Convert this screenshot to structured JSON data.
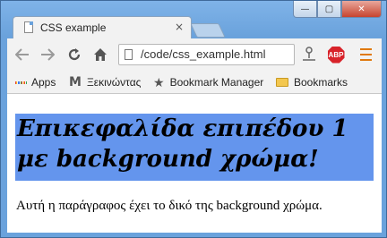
{
  "window": {
    "controls": {
      "minimize": "—",
      "maximize": "▢",
      "close": "✕"
    }
  },
  "tab": {
    "title": "CSS example",
    "close_glyph": "×"
  },
  "toolbar": {
    "back_icon": "back-arrow-icon",
    "forward_icon": "forward-arrow-icon",
    "reload_icon": "reload-icon",
    "home_icon": "home-icon",
    "url": "/code/css_example.html",
    "extensions": {
      "key_icon": "key-icon",
      "abp_label": "ABP",
      "menu_icon": "menu-icon"
    }
  },
  "bookmarks_bar": {
    "items": [
      {
        "label": "Apps",
        "icon": "apps-grid-icon"
      },
      {
        "label": "Ξεκινώντας",
        "icon": "m-icon"
      },
      {
        "label": "Bookmark Manager",
        "icon": "star-icon"
      },
      {
        "label": "Bookmarks",
        "icon": "folder-icon"
      }
    ]
  },
  "page": {
    "heading": "Επικεφαλίδα επιπέδου 1 με background χρώμα!",
    "heading_background": "#6495ed",
    "paragraph": "Αυτή η παράγραφος έχει το δικό της background χρώμα."
  },
  "colors": {
    "frame": "#6aa2dc",
    "toolbar": "#f2f2f2",
    "abp": "#d8232a",
    "menu": "#e07a10"
  }
}
